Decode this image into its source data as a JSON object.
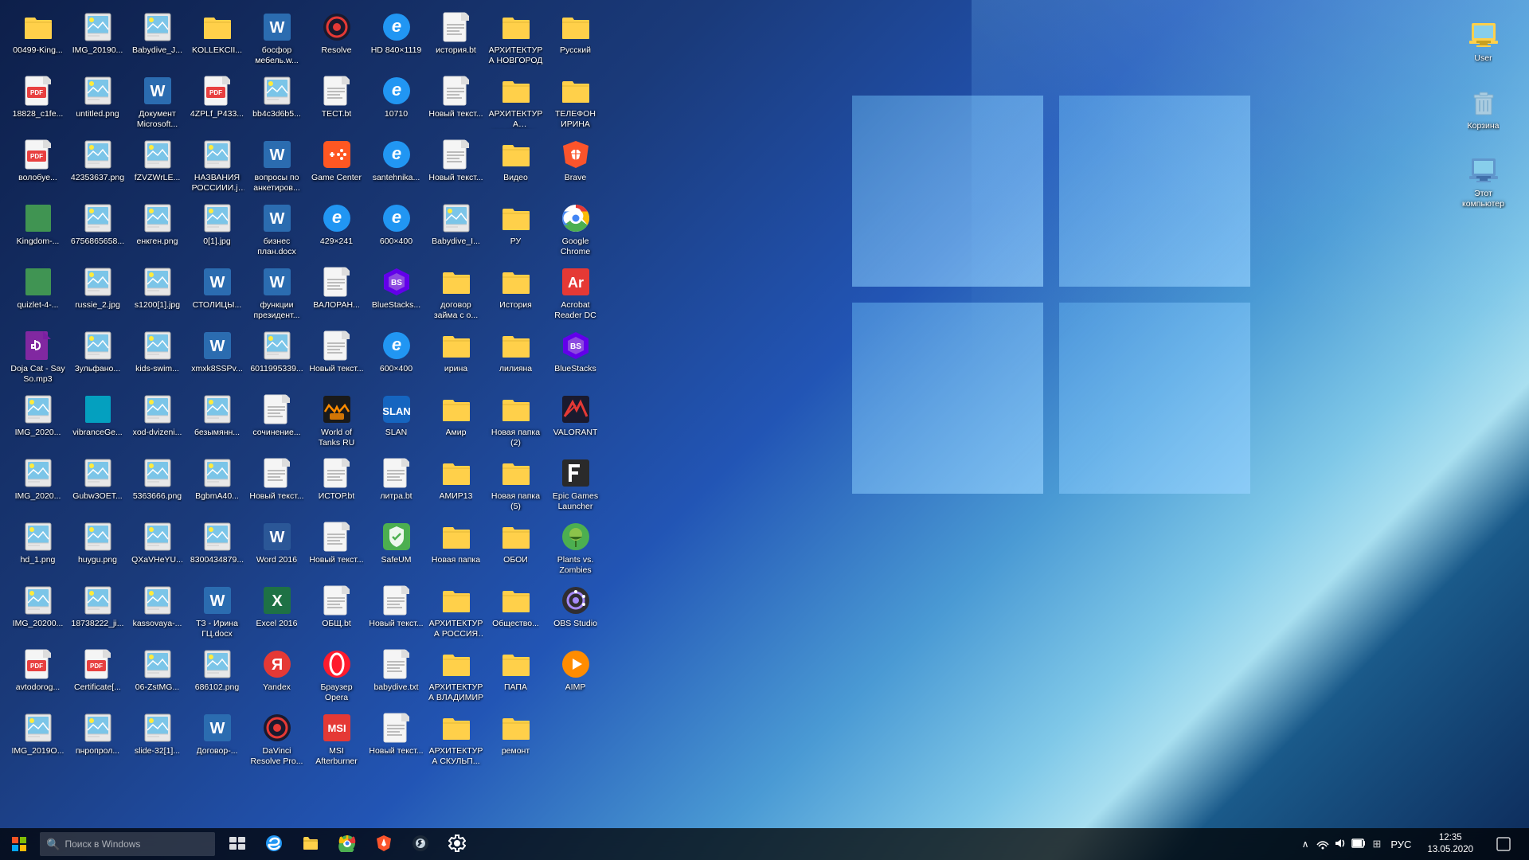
{
  "desktop": {
    "icons_col1": [
      {
        "id": "00499-King",
        "label": "00499-King...",
        "type": "folder",
        "color": "#ffd04a"
      },
      {
        "id": "18828_c1fe",
        "label": "18828_c1fe...",
        "type": "pdf",
        "color": "#e84040"
      },
      {
        "id": "vonolobye",
        "label": "волобуе...",
        "type": "pdf",
        "color": "#e84040"
      },
      {
        "id": "Kingdom",
        "label": "Kingdom-...",
        "type": "app",
        "color": "#4caf50"
      },
      {
        "id": "quizlet-4",
        "label": "quizlet-4-...",
        "type": "app",
        "color": "#4caf50"
      },
      {
        "id": "Doja-Cat",
        "label": "Doja Cat - Say So.mp3",
        "type": "audio",
        "color": "#9c27b0"
      },
      {
        "id": "IMG_2020a",
        "label": "IMG_2020...",
        "type": "img",
        "color": "#4db6e8"
      },
      {
        "id": "IMG_2020b",
        "label": "IMG_2020...",
        "type": "img",
        "color": "#4db6e8"
      },
      {
        "id": "hd_1",
        "label": "hd_1.png",
        "type": "img",
        "color": "#4db6e8"
      }
    ],
    "icons_col2": [
      {
        "id": "IMG_20200",
        "label": "IMG_20200...",
        "type": "img",
        "color": "#4db6e8"
      },
      {
        "id": "avtodorog",
        "label": "avtodorog...",
        "type": "pdf",
        "color": "#e84040"
      },
      {
        "id": "IMG_20190a",
        "label": "IMG_2019O...",
        "type": "img",
        "color": "#4db6e8"
      },
      {
        "id": "IMG_20190b",
        "label": "IMG_20190...",
        "type": "img",
        "color": "#4db6e8"
      },
      {
        "id": "untitled",
        "label": "untitled.png",
        "type": "img",
        "color": "#4db6e8"
      },
      {
        "id": "42353637",
        "label": "42353637.png",
        "type": "img",
        "color": "#4db6e8"
      },
      {
        "id": "67568",
        "label": "6756865658...",
        "type": "img",
        "color": "#4db6e8"
      },
      {
        "id": "russie_2",
        "label": "russie_2.jpg",
        "type": "img",
        "color": "#4db6e8"
      },
      {
        "id": "3yльфано",
        "label": "3ульфано...",
        "type": "img",
        "color": "#4db6e8"
      },
      {
        "id": "vibranceGe",
        "label": "vibranceGe...",
        "type": "app",
        "color": "#00bcd4"
      }
    ],
    "icons_col3": [
      {
        "id": "Gubw3OET",
        "label": "Gubw3OET...",
        "type": "img",
        "color": "#4db6e8"
      },
      {
        "id": "huygu",
        "label": "huygu.png",
        "type": "img",
        "color": "#4db6e8"
      },
      {
        "id": "18738222",
        "label": "18738222_ji...",
        "type": "img",
        "color": "#4db6e8"
      },
      {
        "id": "Certificate",
        "label": "Certificate[...",
        "type": "pdf",
        "color": "#e84040"
      },
      {
        "id": "пнропрол",
        "label": "пнропрол...",
        "type": "img",
        "color": "#4db6e8"
      },
      {
        "id": "Babydive",
        "label": "Babydive_J...",
        "type": "img",
        "color": "#4db6e8"
      },
      {
        "id": "Документ",
        "label": "Документ Microsoft...",
        "type": "word",
        "color": "#2b6cb0"
      },
      {
        "id": "fZVZWrLE",
        "label": "fZVZWrLE...",
        "type": "img",
        "color": "#4db6e8"
      },
      {
        "id": "енкген",
        "label": "енкген.png",
        "type": "img",
        "color": "#4db6e8"
      },
      {
        "id": "s1200",
        "label": "s1200[1].jpg",
        "type": "img",
        "color": "#4db6e8"
      }
    ],
    "icons_col4": [
      {
        "id": "kids-swim",
        "label": "kids-swim...",
        "type": "img",
        "color": "#4db6e8"
      },
      {
        "id": "xod-dviz",
        "label": "xod-dvizeni...",
        "type": "img",
        "color": "#4db6e8"
      },
      {
        "id": "5363666",
        "label": "5363666.png",
        "type": "img",
        "color": "#4db6e8"
      },
      {
        "id": "QXaVHeYu",
        "label": "QXaVHeYU...",
        "type": "img",
        "color": "#4db6e8"
      },
      {
        "id": "kassovaya",
        "label": "kassovaya-...",
        "type": "img",
        "color": "#4db6e8"
      },
      {
        "id": "06-ZstMG",
        "label": "06-ZstMG...",
        "type": "img",
        "color": "#4db6e8"
      },
      {
        "id": "slide-32",
        "label": "slide-32[1]...",
        "type": "img",
        "color": "#4db6e8"
      },
      {
        "id": "KOLLEKCII",
        "label": "KOLLEKCII...",
        "type": "folder",
        "color": "#ffd04a"
      },
      {
        "id": "4ZPLf_P433",
        "label": "4ZPLf_P433...",
        "type": "pdf",
        "color": "#e84040"
      },
      {
        "id": "НАЗВАНИЯ",
        "label": "НАЗВАНИЯ РОССИИИ.jpg",
        "type": "img",
        "color": "#4db6e8"
      }
    ],
    "icons_col5": [
      {
        "id": "0[1]",
        "label": "0[1].jpg",
        "type": "img",
        "color": "#4db6e8"
      },
      {
        "id": "СТОЛИЦЫ",
        "label": "СТОЛИЦЫ...",
        "type": "word",
        "color": "#2b6cb0"
      },
      {
        "id": "xmxk8SSP",
        "label": "xmxk8SSPv...",
        "type": "word",
        "color": "#2b6cb0"
      },
      {
        "id": "безымянн",
        "label": "безымянн...",
        "type": "img",
        "color": "#4db6e8"
      },
      {
        "id": "BgbmA40",
        "label": "BgbmA40...",
        "type": "img",
        "color": "#4db6e8"
      },
      {
        "id": "8300434",
        "label": "8300434879...",
        "type": "img",
        "color": "#4db6e8"
      },
      {
        "id": "ТЗ-Ирина",
        "label": "ТЗ - Ирина ГЦ.docx",
        "type": "word",
        "color": "#2b6cb0"
      },
      {
        "id": "686102",
        "label": "686102.png",
        "type": "img",
        "color": "#4db6e8"
      },
      {
        "id": "Договор",
        "label": "Договор-...",
        "type": "word",
        "color": "#2b6cb0"
      },
      {
        "id": "бoсфор",
        "label": "бoсфор мебель.w...",
        "type": "word",
        "color": "#2b6cb0"
      }
    ],
    "icons_col6": [
      {
        "id": "bb4c3d6b",
        "label": "bb4c3d6b5...",
        "type": "img",
        "color": "#4db6e8"
      },
      {
        "id": "вопросы",
        "label": "вопросы по анкетиров...",
        "type": "word",
        "color": "#2b6cb0"
      },
      {
        "id": "бизнес-план",
        "label": "бизнес план.docx",
        "type": "word",
        "color": "#2b6cb0"
      },
      {
        "id": "функции",
        "label": "функции президент...",
        "type": "word",
        "color": "#2b6cb0"
      },
      {
        "id": "6011995339",
        "label": "6011995339...",
        "type": "img",
        "color": "#4db6e8"
      },
      {
        "id": "сочинение",
        "label": "сочинение...",
        "type": "txt",
        "color": "#ccc"
      },
      {
        "id": "Новый-текст6a",
        "label": "Новый текст...",
        "type": "txt",
        "color": "#ccc"
      },
      {
        "id": "Word-2016",
        "label": "Word 2016",
        "type": "word-app",
        "color": "#2b5797"
      },
      {
        "id": "Excel-2016",
        "label": "Excel 2016",
        "type": "excel-app",
        "color": "#1e7145"
      },
      {
        "id": "Yandex",
        "label": "Yandex",
        "type": "yandex-app",
        "color": "#ff0000"
      }
    ],
    "icons_col7": [
      {
        "id": "DaVinci",
        "label": "DaVinci Resolve Pro...",
        "type": "davinci-app",
        "color": "#222"
      },
      {
        "id": "Resolve",
        "label": "Resolve",
        "type": "davinci-app",
        "color": "#222"
      },
      {
        "id": "TECT_bt",
        "label": "ТЕСТ.bt",
        "type": "txt",
        "color": "#ccc"
      },
      {
        "id": "Game-Center",
        "label": "Game Center",
        "type": "game-app",
        "color": "#ff5722"
      },
      {
        "id": "429x241",
        "label": "429×241",
        "type": "ie-app",
        "color": "#2196f3"
      },
      {
        "id": "ВАЛОРАН",
        "label": "ВАЛОРАН...",
        "type": "txt",
        "color": "#ccc"
      },
      {
        "id": "Новый-текст7a",
        "label": "Новый текст...",
        "type": "txt",
        "color": "#ccc"
      },
      {
        "id": "World-Tanks",
        "label": "World of Tanks RU",
        "type": "wot-app",
        "color": "#ff8c00"
      },
      {
        "id": "ИСТОР_bt",
        "label": "ИСТОР.bt",
        "type": "txt",
        "color": "#ccc"
      },
      {
        "id": "Новый-текст7b",
        "label": "Новый текст...",
        "type": "txt",
        "color": "#ccc"
      },
      {
        "id": "ОБЩ_bt",
        "label": "ОБЩ.bt",
        "type": "txt",
        "color": "#ccc"
      },
      {
        "id": "Браузер-Opera",
        "label": "Браузер Opera",
        "type": "opera-app",
        "color": "#ff1b2d"
      }
    ],
    "icons_col8": [
      {
        "id": "MSI-After",
        "label": "MSI Afterburner",
        "type": "msi-app",
        "color": "#e53935"
      },
      {
        "id": "HD-840",
        "label": "HD 840×1119",
        "type": "ie-app",
        "color": "#2196f3"
      },
      {
        "id": "10710",
        "label": "10710",
        "type": "ie-app",
        "color": "#2196f3"
      },
      {
        "id": "santehnika",
        "label": "santehnika...",
        "type": "ie-app",
        "color": "#2196f3"
      },
      {
        "id": "600x400",
        "label": "600×400",
        "type": "ie-app",
        "color": "#2196f3"
      },
      {
        "id": "BlueStacks-app",
        "label": "BlueStacks...",
        "type": "bluestacks-app",
        "color": "#6200ea"
      },
      {
        "id": "600x400b",
        "label": "600×400",
        "type": "ie-app",
        "color": "#2196f3"
      },
      {
        "id": "SLAN",
        "label": "SLAN",
        "type": "slan-app",
        "color": "#1565c0"
      },
      {
        "id": "литра_bt",
        "label": "литра.bt",
        "type": "txt",
        "color": "#ccc"
      },
      {
        "id": "SafeUM",
        "label": "SafeUM",
        "type": "safeum-app",
        "color": "#4caf50"
      }
    ],
    "icons_col9": [
      {
        "id": "Новый-текст9a",
        "label": "Новый текст...",
        "type": "txt",
        "color": "#ccc"
      },
      {
        "id": "babydive_txt",
        "label": "babydive.txt",
        "type": "txt",
        "color": "#ccc"
      },
      {
        "id": "Новый-текст9b",
        "label": "Новый текст...",
        "type": "txt",
        "color": "#ccc"
      },
      {
        "id": "история_bt",
        "label": "история.bt",
        "type": "txt",
        "color": "#ccc"
      },
      {
        "id": "Новый-текст9c",
        "label": "Новый текст...",
        "type": "txt",
        "color": "#ccc"
      },
      {
        "id": "Новый-текст9d",
        "label": "Новый текст...",
        "type": "txt",
        "color": "#ccc"
      },
      {
        "id": "Babydive_i",
        "label": "Babydive_I...",
        "type": "img",
        "color": "#4db6e8"
      },
      {
        "id": "договор-займа",
        "label": "договор займа с о...",
        "type": "folder",
        "color": "#ffd04a"
      },
      {
        "id": "ирина",
        "label": "ирина",
        "type": "folder",
        "color": "#ffd04a"
      },
      {
        "id": "Амир",
        "label": "Амир",
        "type": "folder",
        "color": "#ffd04a"
      }
    ],
    "icons_col10": [
      {
        "id": "АМИР13",
        "label": "АМИР13",
        "type": "folder",
        "color": "#ffd04a"
      },
      {
        "id": "Новая-папка10a",
        "label": "Новая папка",
        "type": "folder",
        "color": "#ffd04a"
      },
      {
        "id": "АРХИТЕКТУРА-РОССИЯ",
        "label": "АРХИТЕКТУРА РОССИЯ И...",
        "type": "folder",
        "color": "#ffd04a"
      },
      {
        "id": "АРХИТЕКТУРА-ВЛАДИМИР",
        "label": "АРХИТЕКТУРА ВЛАДИМИР",
        "type": "folder",
        "color": "#ffd04a"
      },
      {
        "id": "АРХИТЕКТУРА-СКУЛЬП",
        "label": "АРХИТЕКТУРА СКУЛЬП...",
        "type": "folder",
        "color": "#ffd04a"
      },
      {
        "id": "АРХИТЕКТУРА-НОВГОРОД",
        "label": "АРХИТЕКТУРА НОВГОРОД",
        "type": "folder",
        "color": "#ffd04a"
      },
      {
        "id": "АРХИТЕКТУРА-СКУЛЬПТ",
        "label": "АРХИТЕКТУРА СКУЛЬПТУ...",
        "type": "folder",
        "color": "#ffd04a"
      },
      {
        "id": "Видео",
        "label": "Видео",
        "type": "folder",
        "color": "#ffd04a"
      },
      {
        "id": "РУ",
        "label": "РУ",
        "type": "folder",
        "color": "#ffd04a"
      },
      {
        "id": "История",
        "label": "История",
        "type": "folder",
        "color": "#ffd04a"
      }
    ],
    "icons_col11": [
      {
        "id": "лилияна",
        "label": "лилияна",
        "type": "folder",
        "color": "#ffd04a"
      },
      {
        "id": "Новая-папка11a",
        "label": "Новая папка (2)",
        "type": "folder",
        "color": "#ffd04a"
      },
      {
        "id": "Новая-папка11b",
        "label": "Новая папка (5)",
        "type": "folder",
        "color": "#ffd04a"
      },
      {
        "id": "ОБОИ",
        "label": "ОБОИ",
        "type": "folder",
        "color": "#ffd04a"
      },
      {
        "id": "Общество",
        "label": "Общество...",
        "type": "folder",
        "color": "#ffd04a"
      },
      {
        "id": "ПАПА",
        "label": "ПАПА",
        "type": "folder",
        "color": "#ffd04a"
      },
      {
        "id": "ремонт",
        "label": "ремонт",
        "type": "folder",
        "color": "#ffd04a"
      },
      {
        "id": "Русский",
        "label": "Русский",
        "type": "folder",
        "color": "#ffd04a"
      }
    ],
    "icons_col12": [
      {
        "id": "ТЕЛЕФОН-ИРИНА",
        "label": "ТЕЛЕФОН ИРИНА",
        "type": "folder",
        "color": "#ffd04a"
      },
      {
        "id": "Brave",
        "label": "Brave",
        "type": "brave-app",
        "color": "#fb542b"
      },
      {
        "id": "Google-Chrome",
        "label": "Google Chrome",
        "type": "chrome-app",
        "color": "#4caf50"
      },
      {
        "id": "Acrobat-Reader",
        "label": "Acrobat Reader DC",
        "type": "acrobat-app",
        "color": "#e53935"
      },
      {
        "id": "BlueStacks-icon",
        "label": "BlueStacks",
        "type": "bluestacks-app2",
        "color": "#6200ea"
      },
      {
        "id": "VALORANT",
        "label": "VALORANT",
        "type": "valorant-app",
        "color": "#e53935"
      },
      {
        "id": "Epic-Games",
        "label": "Epic Games Launcher",
        "type": "epic-app",
        "color": "#222"
      },
      {
        "id": "Plants-Zombies",
        "label": "Plants vs. Zombies",
        "type": "plants-app",
        "color": "#4caf50"
      },
      {
        "id": "OBS-Studio",
        "label": "OBS Studio",
        "type": "obs-app",
        "color": "#302e31"
      },
      {
        "id": "AIMP",
        "label": "AIMP",
        "type": "aimp-app",
        "color": "#ff8c00"
      }
    ],
    "right_icons": [
      {
        "id": "User",
        "label": "User",
        "type": "user"
      },
      {
        "id": "Korzina",
        "label": "Корзина",
        "type": "trash"
      },
      {
        "id": "EtotKomputer",
        "label": "Этот компьютер",
        "type": "computer"
      }
    ]
  },
  "taskbar": {
    "start_label": "⊞",
    "search_placeholder": "Поиск в Windows",
    "apps": [
      {
        "id": "taskbar-edge",
        "icon": "🌐",
        "active": false
      },
      {
        "id": "taskbar-explorer",
        "icon": "📁",
        "active": false
      },
      {
        "id": "taskbar-chrome",
        "icon": "◎",
        "active": false
      },
      {
        "id": "taskbar-brave",
        "icon": "🦁",
        "active": false
      },
      {
        "id": "taskbar-steam",
        "icon": "🎮",
        "active": false
      },
      {
        "id": "taskbar-settings",
        "icon": "⚙",
        "active": false
      }
    ],
    "tray": {
      "show_hidden": "^",
      "network": "🌐",
      "volume": "🔊",
      "time": "12:35",
      "date": "13.05.2020",
      "lang": "РУС",
      "notification": "🔔"
    }
  }
}
